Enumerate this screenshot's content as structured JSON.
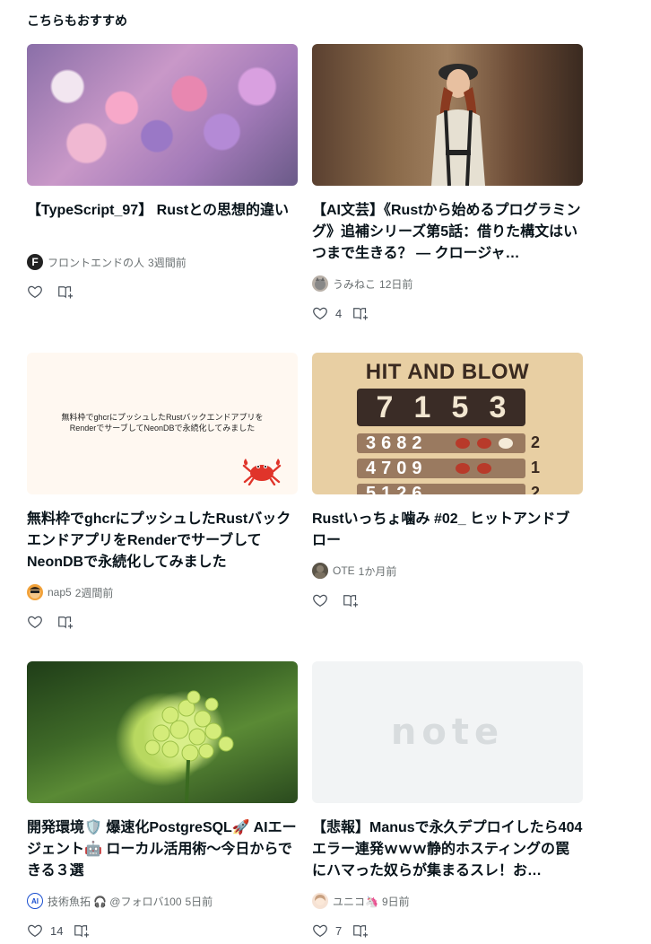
{
  "section": {
    "title": "こちらもおすすめ"
  },
  "cards": [
    {
      "title": "【TypeScript_97】 Rustとの思想的違い",
      "author": "フロントエンドの人",
      "time": "3週間前",
      "likes": "",
      "avatar": "F"
    },
    {
      "title": "【AI文芸】《Rustから始めるプログラミング》追補シリーズ第5話：借りた構文はいつまで生きる？ ― クロージャ…",
      "author": "うみねこ",
      "time": "12日前",
      "likes": "4"
    },
    {
      "title": "無料枠でghcrにプッシュしたRustバックエンドアプリをRenderでサーブしてNeonDBで永続化してみました",
      "author": "nap5",
      "time": "2週間前",
      "likes": "",
      "thumb_text": "無料枠でghcrにプッシュしたRustバックエンドアプリを\nRenderでサーブしてNeonDBで永続化してみました"
    },
    {
      "title": "Rustいっちょ噛み #02_ ヒットアンドブロー",
      "author": "OTE",
      "time": "1か月前",
      "likes": "",
      "thumb": {
        "heading": "HIT AND BLOW",
        "answer": [
          "7",
          "1",
          "5",
          "3"
        ],
        "rows": [
          {
            "digits": "3682",
            "score": "2"
          },
          {
            "digits": "4709",
            "score": "1"
          },
          {
            "digits": "5126",
            "score": "2"
          }
        ]
      }
    },
    {
      "title": "開発環境🛡️ 爆速化PostgreSQL🚀 AIエージェント🤖 ローカル活用術〜今日からできる３選",
      "author": "技術魚拓",
      "author_extra": "🎧 @フォロバ100",
      "time": "5日前",
      "likes": "14",
      "avatar": "AI"
    },
    {
      "title": "【悲報】Manusで永久デプロイしたら404エラー連発ｗｗｗ静的ホスティングの罠にハマった奴らが集まるスレ！お…",
      "author": "ユニコ🦄",
      "time": "9日前",
      "likes": "7",
      "thumb_logo": "note"
    }
  ],
  "icons": {
    "like": "heart-icon",
    "magazine": "magazine-add-icon"
  },
  "colors": {
    "text": "#08131a",
    "meta": "#6a7072",
    "icon": "#48505a"
  }
}
